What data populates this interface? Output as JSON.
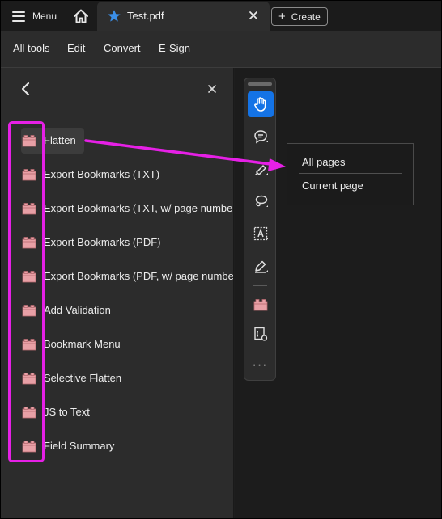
{
  "titlebar": {
    "menu_label": "Menu",
    "tab_title": "Test.pdf",
    "create_label": "Create"
  },
  "toolbar": {
    "items": [
      "All tools",
      "Edit",
      "Convert",
      "E-Sign"
    ]
  },
  "tools_panel": {
    "items": [
      {
        "label": "Flatten",
        "highlighted": true
      },
      {
        "label": "Export Bookmarks (TXT)"
      },
      {
        "label": "Export Bookmarks (TXT, w/ page numbers)"
      },
      {
        "label": "Export Bookmarks (PDF)"
      },
      {
        "label": "Export Bookmarks (PDF, w/ page numbers)"
      },
      {
        "label": "Add Validation"
      },
      {
        "label": "Bookmark Menu"
      },
      {
        "label": "Selective Flatten"
      },
      {
        "label": "JS to Text"
      },
      {
        "label": "Field Summary"
      }
    ]
  },
  "context_menu": {
    "options": [
      "All pages",
      "Current page"
    ]
  },
  "colors": {
    "accent": "#1473e6",
    "annotation": "#e620e6",
    "tool_icon": "#e8a0a6"
  },
  "icons": {
    "vertical_toolbar": [
      "hand-icon",
      "comment-icon",
      "highlighter-icon",
      "lasso-icon",
      "text-select-icon",
      "pen-icon",
      "plugin-icon",
      "script-icon",
      "more-icon"
    ]
  }
}
